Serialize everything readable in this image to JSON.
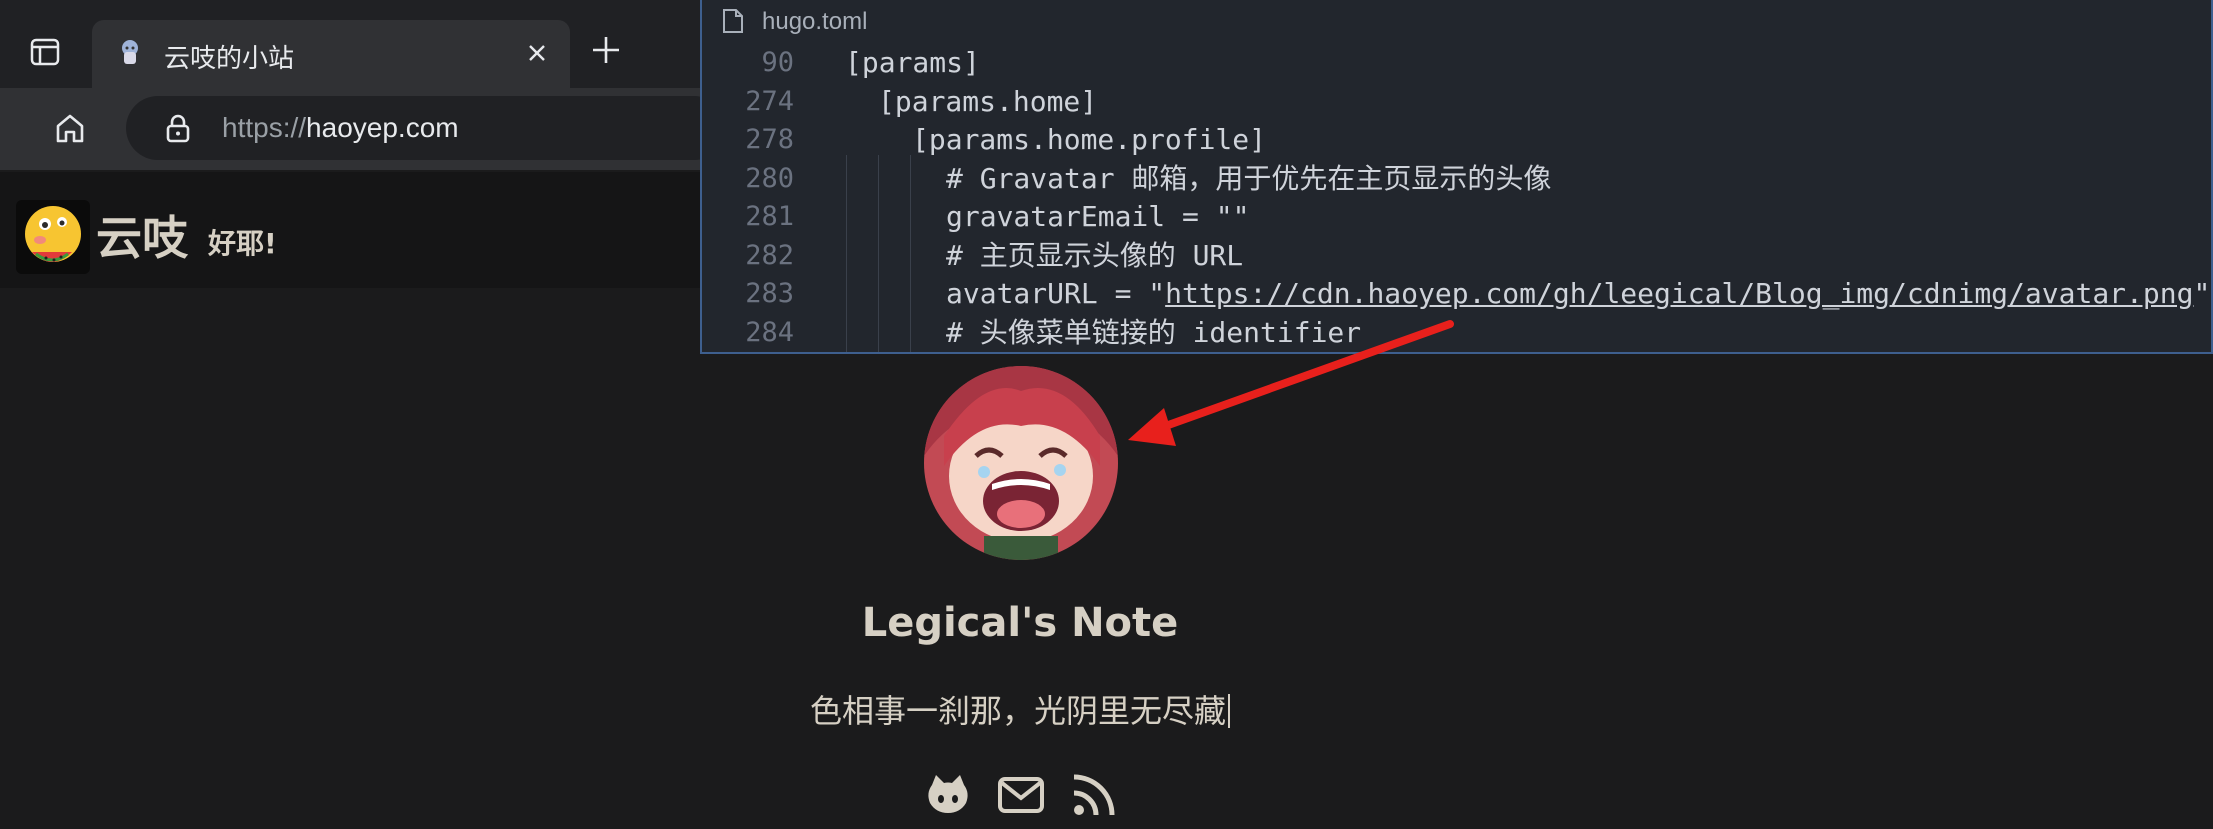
{
  "browser": {
    "tab": {
      "title": "云吱的小站"
    },
    "address": {
      "scheme": "https://",
      "host": "haoyep.com"
    }
  },
  "site": {
    "name": "云吱",
    "greeting": "好耶!"
  },
  "profile": {
    "title": "Legical's Note",
    "subtitle": "色相事一刹那，光阴里无尽藏"
  },
  "social_icons": [
    "github-icon",
    "email-icon",
    "rss-icon"
  ],
  "editor": {
    "file_name": "hugo.toml",
    "lines": [
      {
        "num": "90",
        "text": "[params]"
      },
      {
        "num": "274",
        "text": "[params.home]"
      },
      {
        "num": "278",
        "text": "[params.home.profile]"
      },
      {
        "num": "280",
        "text": "# Gravatar 邮箱，用于优先在主页显示的头像"
      },
      {
        "num": "281",
        "text": "gravatarEmail = \"\""
      },
      {
        "num": "282",
        "text": "# 主页显示头像的 URL"
      },
      {
        "num": "283",
        "prefix": "avatarURL = \"",
        "link": "https://cdn.haoyep.com/gh/leegical/Blog_img/cdnimg/avatar.png",
        "suffix": "\""
      },
      {
        "num": "284",
        "text": "#  头像菜单链接的 identifier"
      }
    ]
  },
  "colors": {
    "page_background": "#1b1b1c",
    "text": "#d6d0c4",
    "editor_background": "#22262d",
    "annotation_arrow": "#e8201c"
  }
}
